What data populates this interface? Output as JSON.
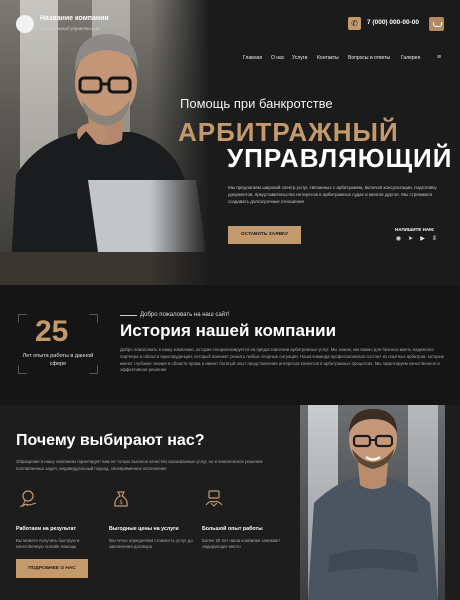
{
  "header": {
    "company_name": "Название компании",
    "company_subtitle": "Арбитражный управляющий",
    "phone": "7 (000) 000-00-00",
    "phone_icon": "phone-icon",
    "call_icon": "mail-icon"
  },
  "nav": {
    "items": [
      "Главная",
      "О нас",
      "Услуги",
      "Контакты",
      "Вопросы и ответы",
      "Галерея"
    ],
    "menu_icon": "hamburger-icon"
  },
  "hero": {
    "pre_title": "Помощь при банкротстве",
    "title_line1": "АРБИТРАЖНЫЙ",
    "title_line2": "УПРАВЛЯЮЩИЙ",
    "description": "Мы предлагаем широкий спектр услуг, связанных с арбитражем, включая консультации, подготовку документов, представительство интересов в арбитражных судах и многое другое. Мы стремимся создавать долгосрочные отношения",
    "cta_label": "ОСТАВИТЬ ЗАЯВКУ",
    "write_us_label": "НАПИШИТЕ НАМ:",
    "socials": [
      "whatsapp-icon",
      "telegram-icon",
      "youtube-icon",
      "vk-icon"
    ],
    "photo_icon": "man-with-laptop-photo"
  },
  "history": {
    "years_number": "25",
    "years_text": "Лет опыта работы в данной сфере",
    "welcome": "Добро пожаловать на наш сайт!",
    "title": "История нашей компании",
    "text": "Добро пожаловать в нашу компанию, которая специализируется на предоставлении арбитражных услуг. Мы знаем, как важно для бизнеса иметь надежного партнера в области юриспруденции, который поможет решить любые спорные ситуации. Наша команда профессионалов состоит из опытных арбитров, которые имеют глубокие знания в области права и имеют богатый опыт представления интересов клиентов в арбитражных процессах. Мы гарантируем качественное и эффективное решение"
  },
  "why": {
    "title": "Почему выбирают нас?",
    "description": "Обращение в нашу компанию гарантирует вам не только высокое качество оказываемых услуг, но и комплексное решение поставленных задач, индивидуальный подход, своевременное исполнение",
    "features": [
      {
        "icon": "award-hand-icon",
        "title": "Работаем на результат",
        "text": "Вы можете получить быструю и качественную онлайн помощь"
      },
      {
        "icon": "money-bag-icon",
        "title": "Выгодные цены на услуги",
        "text": "Мы четко определяем стоимость услуг до заключения договора"
      },
      {
        "icon": "handshake-icon",
        "title": "Большой опыт работы",
        "text": "Более 25 лет наша компания занимает лидирующее место"
      }
    ],
    "more_label": "ПОДРОБНЕЕ О НАС",
    "photo_icon": "smiling-man-photo"
  },
  "colors": {
    "accent": "#c49a6c",
    "background": "#151515",
    "section": "#1d1d1d"
  }
}
